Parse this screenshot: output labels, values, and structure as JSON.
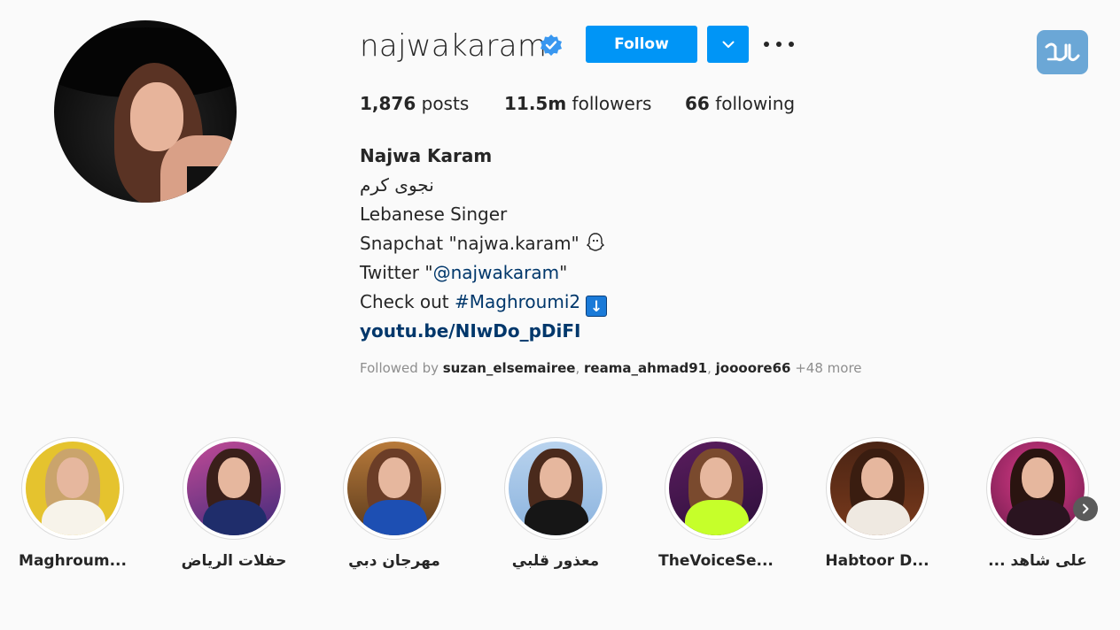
{
  "profile": {
    "username": "najwakaram",
    "verified": true,
    "follow_label": "Follow",
    "accent_color": "#0095f6"
  },
  "stats": {
    "posts_count": "1,876",
    "posts_label": " posts",
    "followers_count": "11.5m",
    "followers_label": " followers",
    "following_count": "66",
    "following_label": " following"
  },
  "bio": {
    "name": "Najwa Karam",
    "arabic_name": "نجوى كرم",
    "line_title": "Lebanese Singer",
    "snapchat": "Snapchat \"najwa.karam\"",
    "twitter_prefix": "Twitter \"",
    "twitter_handle": "@najwakaram",
    "twitter_suffix": "\"",
    "check_prefix": "Check out ",
    "hashtag": "#Maghroumi2",
    "url": "youtu.be/NIwDo_pDiFI",
    "emoji_icons": [
      "ghost-icon",
      "down-arrow-icon"
    ]
  },
  "followed_by": {
    "prefix": "Followed by ",
    "user1": "suzan_elsemairee",
    "sep1": ", ",
    "user2": "reama_ahmad91",
    "sep2": ", ",
    "user3": "joooore66",
    "more": " +48 more"
  },
  "highlights": [
    {
      "label": "Maghroum..."
    },
    {
      "label": "حفلات الرياض"
    },
    {
      "label": "مهرجان دبي"
    },
    {
      "label": "معذور قلبي"
    },
    {
      "label": "TheVoiceSe..."
    },
    {
      "label": "Habtoor D..."
    },
    {
      "label": "... على شاهد"
    }
  ]
}
